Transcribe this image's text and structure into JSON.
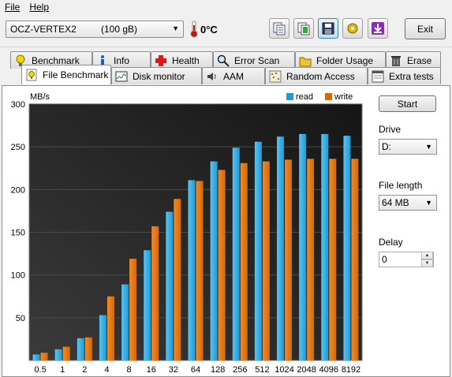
{
  "menu": {
    "file": "File",
    "help": "Help"
  },
  "toolbar": {
    "drive_name": "OCZ-VERTEX2",
    "drive_size": "(100 gB)",
    "temperature": "0°C",
    "exit_label": "Exit",
    "buttons": [
      "copy-info-icon",
      "copy-all-icon",
      "save-icon",
      "options-icon",
      "download-icon"
    ]
  },
  "tabs_top": [
    {
      "label": "Benchmark",
      "icon": "bulb-icon"
    },
    {
      "label": "Info",
      "icon": "info-icon"
    },
    {
      "label": "Health",
      "icon": "health-cross-icon"
    },
    {
      "label": "Error Scan",
      "icon": "magnifier-icon"
    },
    {
      "label": "Folder Usage",
      "icon": "folder-icon"
    },
    {
      "label": "Erase",
      "icon": "trash-icon"
    }
  ],
  "tabs_bottom": [
    {
      "label": "File Benchmark",
      "icon": "file-bulb-icon"
    },
    {
      "label": "Disk monitor",
      "icon": "disk-monitor-icon"
    },
    {
      "label": "AAM",
      "icon": "speaker-icon"
    },
    {
      "label": "Random Access",
      "icon": "random-access-icon"
    },
    {
      "label": "Extra tests",
      "icon": "extra-tests-icon"
    }
  ],
  "controls": {
    "start_label": "Start",
    "drive_label": "Drive",
    "drive_value": "D:",
    "file_length_label": "File length",
    "file_length_value": "64 MB",
    "delay_label": "Delay",
    "delay_value": "0"
  },
  "colors": {
    "read": "#1e9ad6",
    "write": "#d46a0a",
    "plot_bg": "#151515"
  },
  "chart_data": {
    "type": "bar",
    "ylabel": "MB/s",
    "ylim": [
      0,
      300
    ],
    "yticks": [
      50,
      100,
      150,
      200,
      250,
      300
    ],
    "categories": [
      "0.5",
      "1",
      "2",
      "4",
      "8",
      "16",
      "32",
      "64",
      "128",
      "256",
      "512",
      "1024",
      "2048",
      "4096",
      "8192"
    ],
    "series": [
      {
        "name": "read",
        "values": [
          7,
          13,
          26,
          53,
          89,
          129,
          174,
          211,
          233,
          249,
          256,
          262,
          265,
          265,
          263
        ]
      },
      {
        "name": "write",
        "values": [
          9,
          16,
          27,
          75,
          119,
          157,
          189,
          210,
          223,
          231,
          233,
          235,
          236,
          236,
          236
        ]
      }
    ],
    "legend": "top-right"
  }
}
